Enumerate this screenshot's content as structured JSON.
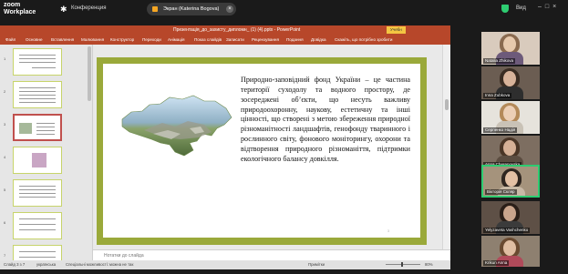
{
  "zoom": {
    "brand_line1": "zoom",
    "brand_line2": "Workplace",
    "conference_label": "Конференция",
    "share_label": "Экран (Katerina Bogova)",
    "view_label": "Вид"
  },
  "ppt": {
    "title": "Презентація_до_захисту_дипломн_ (1) (4).pptx  -  PowerPoint",
    "user_badge": "Учебн",
    "tabs": [
      "Файл",
      "Основне",
      "Вставлення",
      "Малювання",
      "Конструктор",
      "Переходи",
      "Анімація",
      "Показ слайдів",
      "Записати",
      "Рецензування",
      "Подання",
      "Довідка",
      "Скажіть, що потрібно зробити"
    ],
    "thumbnail_numbers": [
      "1",
      "2",
      "3",
      "4",
      "5",
      "6",
      "7"
    ],
    "slide_text": "Природно-заповідний фонд України – це частина території суходолу та водного простору, де зосереджені об’єкти, що несуть важливу природоохоронну, наукову, естетичну та інші цінності, що створені з метою збереження природної різноманітності ландшафтів, генофонду тваринного і рослинного світу, фонового моніторингу, охорони та відтворення природного різноманіття, підтримки екологічного балансу довкілля.",
    "slide_number": "3",
    "notes_placeholder": "Нотатки до слайда",
    "status": {
      "slide": "Слайд 3 з 7",
      "language": "українська",
      "accessibility": "Спеціальні можливості: можна не так",
      "notes": "Примітки",
      "zoom": "80%"
    }
  },
  "participants": [
    {
      "name": "Natalia Zhikova",
      "color": "#c9a98e",
      "active": false
    },
    {
      "name": "Inna Zubkova",
      "color": "#8a7b6a",
      "active": false
    },
    {
      "name": "Серпенко Надія",
      "color": "#d9d6cf",
      "active": false
    },
    {
      "name": "Anna Cherepovska",
      "color": "#9c8c7a",
      "active": false
    },
    {
      "name": "Вікторія Скляр",
      "color": "#b5a38e",
      "active": true
    },
    {
      "name": "Yelyzaveta Vashchenko",
      "color": "#7e6e60",
      "active": false
    },
    {
      "name": "Krikun Anna",
      "color": "#a0907e",
      "active": false
    }
  ],
  "colors": {
    "ppt_accent": "#b7472a",
    "slide_frame": "#9aa93a",
    "active_speaker": "#2ecc71"
  }
}
